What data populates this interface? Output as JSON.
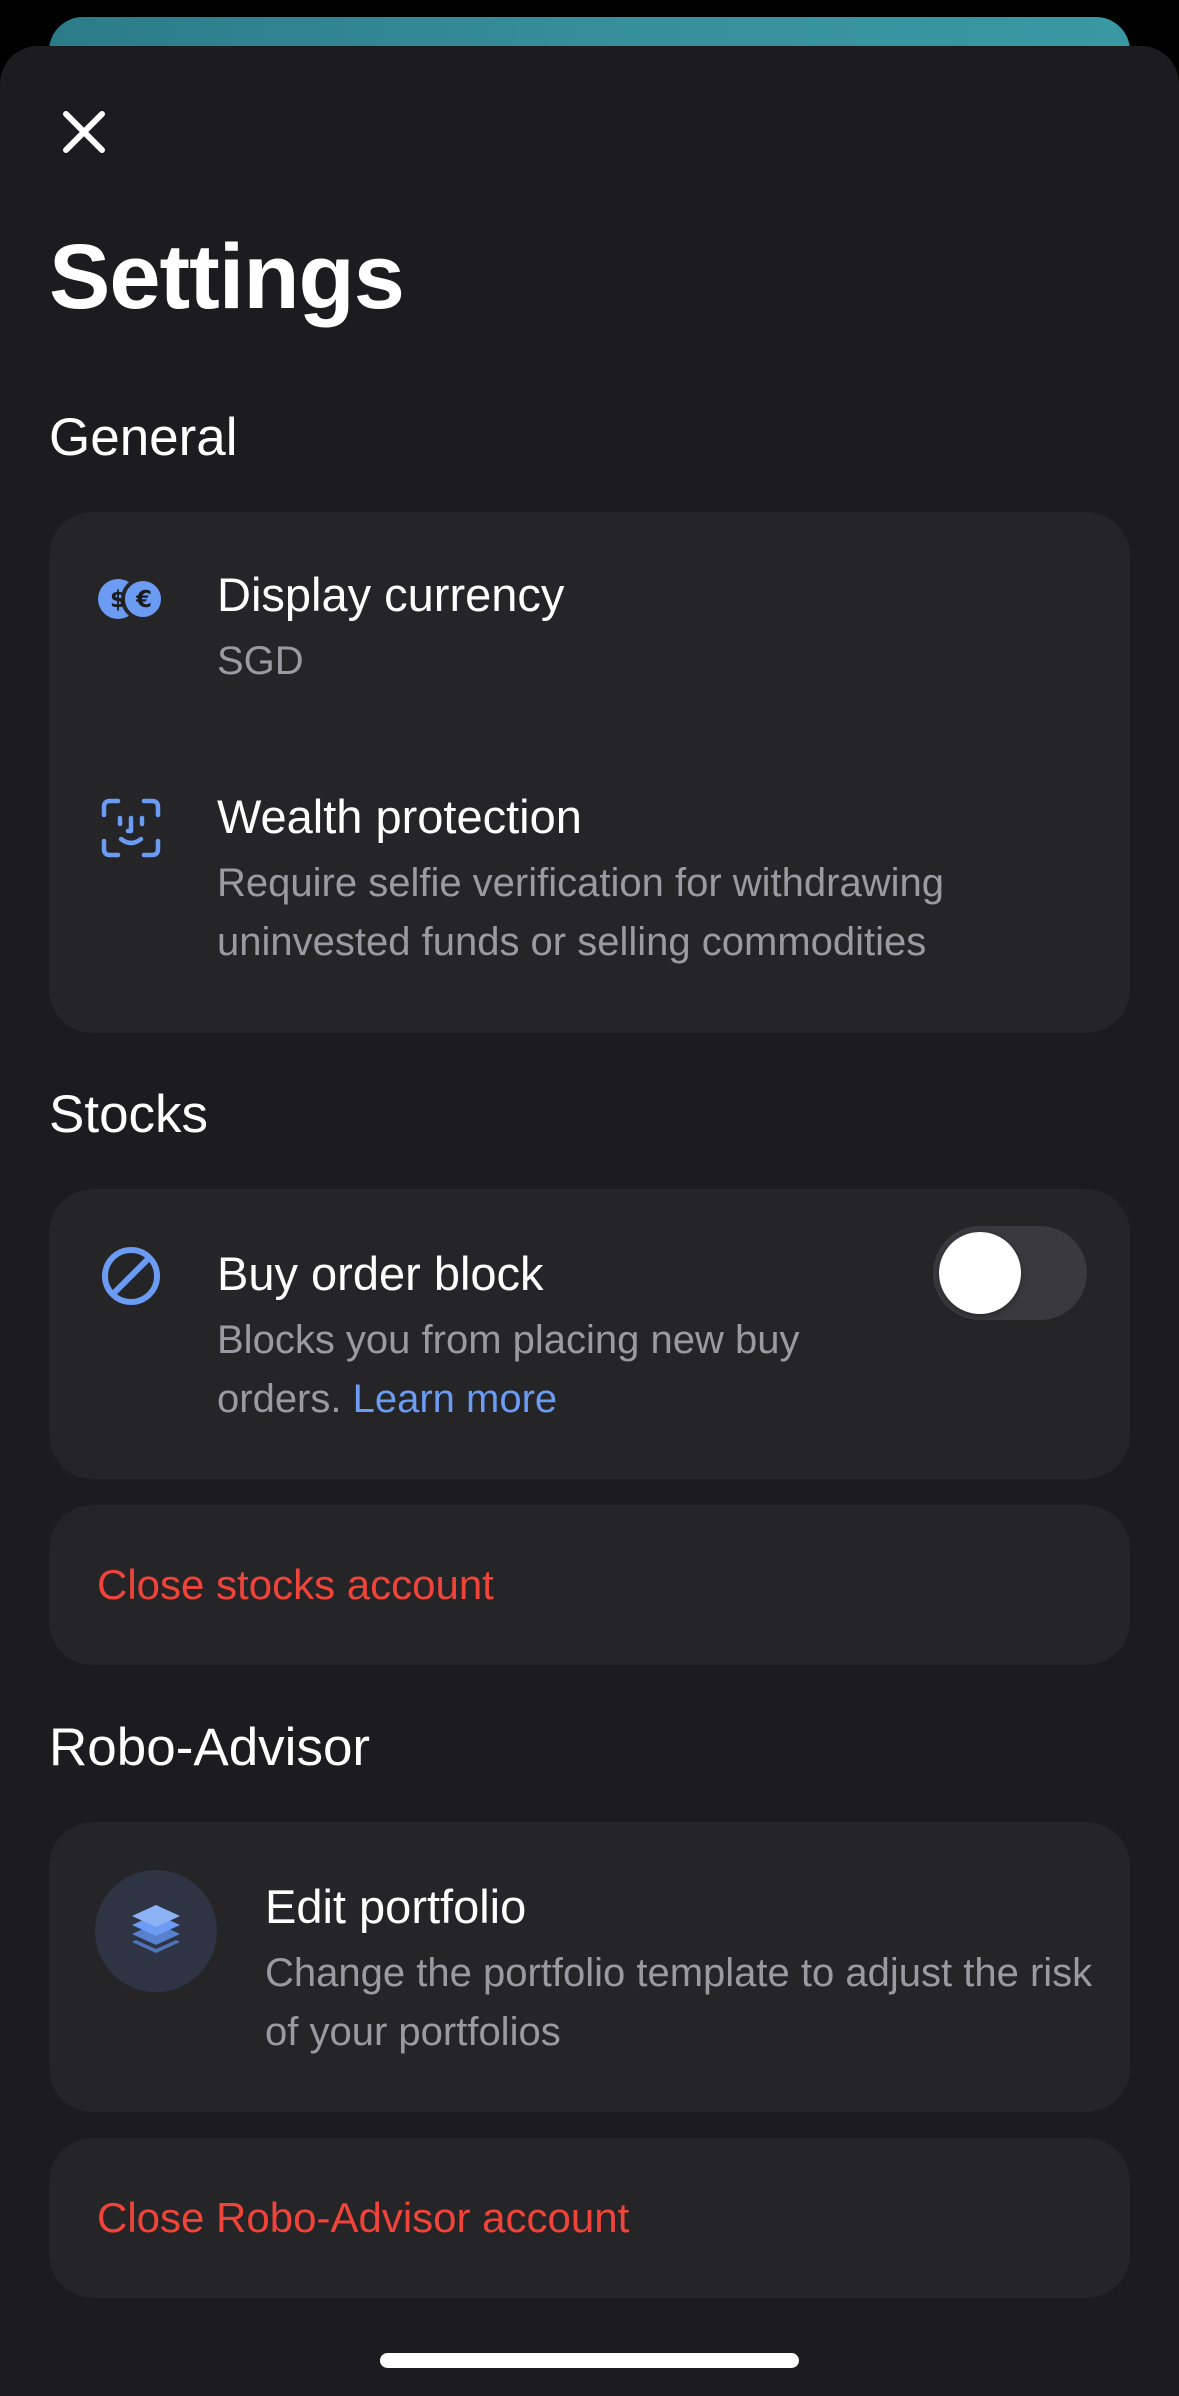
{
  "screen": {
    "title": "Settings"
  },
  "sections": {
    "general": {
      "title": "General",
      "display_currency": {
        "title": "Display currency",
        "value": "SGD",
        "icon": "currency-exchange-icon"
      },
      "wealth_protection": {
        "title": "Wealth protection",
        "description": "Require selfie verification for withdrawing uninvested funds or selling commodities",
        "icon": "face-id-icon"
      }
    },
    "stocks": {
      "title": "Stocks",
      "buy_order_block": {
        "title": "Buy order block",
        "description": "Blocks you from placing new buy orders.",
        "link_label": "Learn more",
        "enabled": false,
        "icon": "block-icon"
      },
      "close_account_label": "Close stocks account"
    },
    "robo_advisor": {
      "title": "Robo-Advisor",
      "edit_portfolio": {
        "title": "Edit portfolio",
        "description": "Change the portfolio template to adjust the risk of your portfolios",
        "icon": "layers-icon"
      },
      "close_account_label": "Close Robo-Advisor account"
    }
  },
  "colors": {
    "background": "#000000",
    "sheet": "#1c1c1e",
    "card": "#252527",
    "accent_blue": "#6b9bf2",
    "danger_red": "#f0443a",
    "muted_text": "#9a9aa0"
  }
}
